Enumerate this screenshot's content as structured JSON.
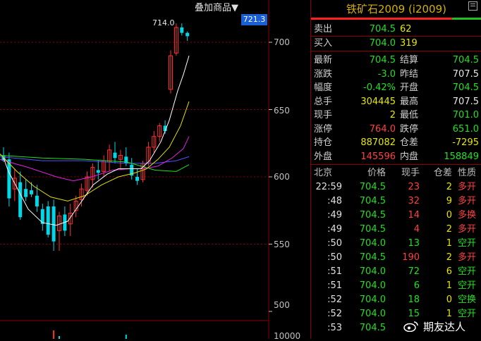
{
  "chart": {
    "overlay_label": "叠加商品▼",
    "current_price_tag": "721.3",
    "high_label": "714.0",
    "y_ticks": [
      "700",
      "650",
      "600",
      "550",
      "500",
      "10000"
    ],
    "price_axis": {
      "min": 500,
      "max": 725
    },
    "colors": {
      "up": "#ff3030",
      "down": "#00d8e8",
      "ma_white": "#ffffff",
      "ma_yellow": "#e0e000",
      "ma_magenta": "#e020e0",
      "ma_green": "#20e020",
      "ma_blue": "#5050ff",
      "grid": "#8b0000"
    },
    "candles": [
      {
        "o": 616,
        "h": 622,
        "l": 611,
        "c": 612
      },
      {
        "o": 613,
        "h": 618,
        "l": 578,
        "c": 584
      },
      {
        "o": 591,
        "h": 606,
        "l": 582,
        "c": 599
      },
      {
        "o": 596,
        "h": 604,
        "l": 568,
        "c": 570
      },
      {
        "o": 591,
        "h": 598,
        "l": 582,
        "c": 585
      },
      {
        "o": 590,
        "h": 596,
        "l": 585,
        "c": 587
      },
      {
        "o": 586,
        "h": 594,
        "l": 574,
        "c": 578
      },
      {
        "o": 576,
        "h": 580,
        "l": 560,
        "c": 565
      },
      {
        "o": 578,
        "h": 582,
        "l": 555,
        "c": 557
      },
      {
        "o": 578,
        "h": 583,
        "l": 545,
        "c": 552
      },
      {
        "o": 560,
        "h": 574,
        "l": 545,
        "c": 571
      },
      {
        "o": 572,
        "h": 578,
        "l": 556,
        "c": 560
      },
      {
        "o": 565,
        "h": 580,
        "l": 556,
        "c": 573
      },
      {
        "o": 575,
        "h": 586,
        "l": 570,
        "c": 582
      },
      {
        "o": 583,
        "h": 595,
        "l": 578,
        "c": 591
      },
      {
        "o": 590,
        "h": 604,
        "l": 586,
        "c": 600
      },
      {
        "o": 598,
        "h": 610,
        "l": 592,
        "c": 607
      },
      {
        "o": 605,
        "h": 612,
        "l": 598,
        "c": 603
      },
      {
        "o": 604,
        "h": 616,
        "l": 600,
        "c": 612
      },
      {
        "o": 611,
        "h": 624,
        "l": 604,
        "c": 620
      },
      {
        "o": 618,
        "h": 626,
        "l": 610,
        "c": 614
      },
      {
        "o": 613,
        "h": 620,
        "l": 605,
        "c": 616
      },
      {
        "o": 615,
        "h": 622,
        "l": 608,
        "c": 610
      },
      {
        "o": 609,
        "h": 614,
        "l": 598,
        "c": 601
      },
      {
        "o": 600,
        "h": 606,
        "l": 594,
        "c": 597
      },
      {
        "o": 598,
        "h": 612,
        "l": 596,
        "c": 610
      },
      {
        "o": 610,
        "h": 626,
        "l": 608,
        "c": 622
      },
      {
        "o": 622,
        "h": 634,
        "l": 618,
        "c": 630
      },
      {
        "o": 630,
        "h": 640,
        "l": 626,
        "c": 638
      },
      {
        "o": 638,
        "h": 642,
        "l": 632,
        "c": 634
      },
      {
        "o": 665,
        "h": 694,
        "l": 662,
        "c": 690
      },
      {
        "o": 692,
        "h": 714,
        "l": 690,
        "c": 711
      },
      {
        "o": 711,
        "h": 714,
        "l": 705,
        "c": 707
      },
      {
        "o": 707,
        "h": 708,
        "l": 701,
        "c": 704.5
      }
    ],
    "ma": {
      "white": [
        [
          5,
          614
        ],
        [
          12,
          604
        ],
        [
          24,
          592
        ],
        [
          40,
          576
        ],
        [
          60,
          566
        ],
        [
          80,
          564
        ],
        [
          96,
          567
        ],
        [
          112,
          579
        ],
        [
          132,
          594
        ],
        [
          152,
          602
        ],
        [
          168,
          606
        ],
        [
          184,
          606
        ],
        [
          200,
          606
        ],
        [
          212,
          612
        ],
        [
          228,
          626
        ],
        [
          240,
          642
        ],
        [
          252,
          664
        ],
        [
          260,
          676
        ],
        [
          268,
          690
        ]
      ],
      "yellow": [
        [
          0,
          617
        ],
        [
          24,
          604
        ],
        [
          48,
          593
        ],
        [
          72,
          585
        ],
        [
          96,
          582
        ],
        [
          120,
          586
        ],
        [
          144,
          594
        ],
        [
          168,
          600
        ],
        [
          192,
          603
        ],
        [
          208,
          606
        ],
        [
          224,
          613
        ],
        [
          240,
          622
        ],
        [
          256,
          638
        ],
        [
          268,
          656
        ]
      ],
      "magenta": [
        [
          0,
          613
        ],
        [
          40,
          607
        ],
        [
          80,
          600
        ],
        [
          104,
          597
        ],
        [
          130,
          600
        ],
        [
          160,
          605
        ],
        [
          184,
          606
        ],
        [
          204,
          606
        ],
        [
          224,
          608
        ],
        [
          244,
          614
        ],
        [
          260,
          621
        ],
        [
          268,
          630
        ]
      ],
      "blue": [
        [
          0,
          615
        ],
        [
          60,
          612
        ],
        [
          120,
          612
        ],
        [
          180,
          610
        ],
        [
          220,
          610
        ],
        [
          250,
          612
        ],
        [
          268,
          615
        ]
      ],
      "green": [
        [
          0,
          616
        ],
        [
          60,
          614
        ],
        [
          120,
          613
        ],
        [
          180,
          611
        ],
        [
          220,
          605
        ],
        [
          250,
          604
        ],
        [
          268,
          609
        ]
      ]
    },
    "volume_bars": [
      {
        "idx": 9,
        "v": 0.6,
        "up": true
      },
      {
        "idx": 10,
        "v": 0.2,
        "up": false
      },
      {
        "idx": 22,
        "v": 0.3,
        "up": false
      }
    ]
  },
  "panel": {
    "title": "铁矿石2009 (i2009)",
    "sell": {
      "label": "卖出",
      "price": "704.5",
      "qty": "62"
    },
    "buy": {
      "label": "买入",
      "price": "704.0",
      "qty": "319"
    },
    "stats": [
      [
        {
          "label": "最新",
          "value": "704.5",
          "color": "green"
        },
        {
          "label": "结算",
          "value": "704.5",
          "color": "green"
        }
      ],
      [
        {
          "label": "涨跌",
          "value": "-3.0",
          "color": "green"
        },
        {
          "label": "昨结",
          "value": "707.5",
          "color": "white"
        }
      ],
      [
        {
          "label": "幅度",
          "value": "-0.42%",
          "color": "green"
        },
        {
          "label": "开盘",
          "value": "704.5",
          "color": "green"
        }
      ],
      [
        {
          "label": "总手",
          "value": "304445",
          "color": "yellow"
        },
        {
          "label": "最高",
          "value": "707.5",
          "color": "white"
        }
      ],
      [
        {
          "label": "现手",
          "value": "2",
          "color": "yellow"
        },
        {
          "label": "最低",
          "value": "701.0",
          "color": "green"
        }
      ],
      [
        {
          "label": "涨停",
          "value": "764.0",
          "color": "red"
        },
        {
          "label": "跌停",
          "value": "651.0",
          "color": "green"
        }
      ],
      [
        {
          "label": "持仓",
          "value": "887082",
          "color": "yellow"
        },
        {
          "label": "仓差",
          "value": "-7295",
          "color": "yellow"
        }
      ],
      [
        {
          "label": "外盘",
          "value": "145596",
          "color": "red"
        },
        {
          "label": "内盘",
          "value": "158849",
          "color": "green"
        }
      ]
    ],
    "trade_header": {
      "time": "北京",
      "price": "价格",
      "vol": "现手",
      "oi": "仓差",
      "type": "性质"
    },
    "trades": [
      {
        "time": "22:59",
        "price": "704.5",
        "vol": "23",
        "oi": "2",
        "type": "多开",
        "pc": "green",
        "vc": "red",
        "tc": "red"
      },
      {
        "time": ":48",
        "price": "704.5",
        "vol": "32",
        "oi": "9",
        "type": "多开",
        "pc": "green",
        "vc": "red",
        "tc": "red"
      },
      {
        "time": ":49",
        "price": "704.5",
        "vol": "14",
        "oi": "0",
        "type": "多换",
        "pc": "green",
        "vc": "red",
        "tc": "red"
      },
      {
        "time": ":49",
        "price": "704.5",
        "vol": "4",
        "oi": "2",
        "type": "多开",
        "pc": "green",
        "vc": "red",
        "tc": "red"
      },
      {
        "time": ":50",
        "price": "704.0",
        "vol": "13",
        "oi": "1",
        "type": "空开",
        "pc": "green",
        "vc": "green",
        "tc": "green"
      },
      {
        "time": ":50",
        "price": "704.5",
        "vol": "190",
        "oi": "2",
        "type": "多开",
        "pc": "green",
        "vc": "red",
        "tc": "red"
      },
      {
        "time": ":51",
        "price": "704.0",
        "vol": "72",
        "oi": "6",
        "type": "空开",
        "pc": "green",
        "vc": "green",
        "tc": "green"
      },
      {
        "time": ":51",
        "price": "704.0",
        "vol": "6",
        "oi": "1",
        "type": "空开",
        "pc": "green",
        "vc": "green",
        "tc": "green"
      },
      {
        "time": ":52",
        "price": "704.0",
        "vol": "18",
        "oi": "0",
        "type": "空换",
        "pc": "green",
        "vc": "green",
        "tc": "green"
      },
      {
        "time": ":52",
        "price": "704.0",
        "vol": "15",
        "oi": "1",
        "type": "空开",
        "pc": "green",
        "vc": "green",
        "tc": "green"
      },
      {
        "time": ":53",
        "price": "704.5",
        "vol": "",
        "oi": "",
        "type": "",
        "pc": "green",
        "vc": "red",
        "tc": "red"
      }
    ]
  },
  "watermark": {
    "text": "期友达人",
    "icon": "weibo-icon"
  }
}
